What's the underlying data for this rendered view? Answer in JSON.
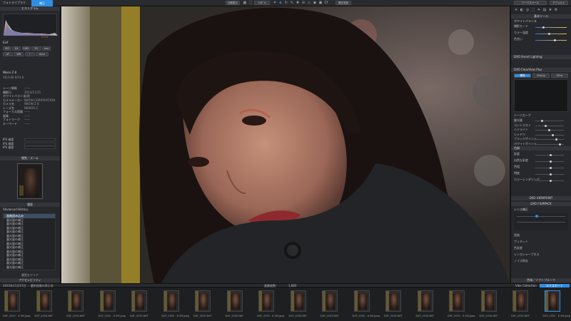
{
  "topbar": {
    "tab_label": "フォトライブラリ",
    "active_tab": "補正",
    "compare_label": "比較表示",
    "zoom_label": "100 %",
    "preview_label": "Cf",
    "export_label": "補正前後",
    "right_label": "ワークスペース",
    "right_btn": "デフォルト"
  },
  "left": {
    "histogram_title": "ヒストグラム",
    "hist_values": "0 0 0",
    "info_title": "Exif",
    "info_rows": [
      {
        "k": "シーン情報",
        "v": "——"
      },
      {
        "k": "撮影日",
        "v": "2023/11/15"
      },
      {
        "k": "ホワイトバランス",
        "v": "自動"
      },
      {
        "k": "カメラメーカー",
        "v": "NIKON CORPORATION"
      },
      {
        "k": "カメラ名",
        "v": "NIKON Z 8"
      },
      {
        "k": "レンズ名",
        "v": "NIKKOR Z"
      },
      {
        "k": "フォーカス距離",
        "v": "——"
      },
      {
        "k": "画質",
        "v": "——"
      },
      {
        "k": "フォトマーク",
        "v": "——"
      },
      {
        "k": "キーワード",
        "v": "——"
      }
    ],
    "camera_text": "Nikon Z 8",
    "camera_sub": "28.0-80.0/F4.0",
    "ips_rows": [
      "IPS 検索",
      "IPS 検索",
      "IPS 検索"
    ],
    "navigator_title": "閲覧／ズーム",
    "history_title": "履歴",
    "history_header": "Advanced History",
    "history_items": [
      "画像読み込み",
      "露光量の補正",
      "露光量の補正",
      "露光量の補正",
      "露光量の補正",
      "露光量の補正",
      "露光量の補正",
      "露光量の補正",
      "露光量の補正",
      "露光量の補正",
      "露光量の補正",
      "露光量の補正",
      "露光量の補正",
      "露光量の補正"
    ],
    "history_footer": "履歴をクリア",
    "bottom_tab": "アクセシビリティ"
  },
  "right": {
    "header": "基本ツール",
    "section1": "ホワイトバランス",
    "wb_rows": [
      "撮影モード",
      "カラー温度",
      "色合い"
    ],
    "section2": "DXO Smart Lighting",
    "section3": "DXO ClearView Plus",
    "preset_labels": [
      "標準",
      "Strong",
      "Ultra"
    ],
    "section4": "トーンカーブ",
    "slider_labels": [
      "露光量",
      "コントラスト",
      "ハイライト",
      "シャドウ",
      "ブラックポイント",
      "ホワイトポイント"
    ],
    "section5": "色調",
    "color_rows": [
      "彩度",
      "自然な彩度",
      "色相",
      "明度",
      "カラーレンダリング"
    ],
    "section6": "DXO VIEWPOINT",
    "section7": "DXO FILMPACK",
    "section8": "レンズ補正",
    "lens_rows": [
      "歪曲",
      "ヴィネット",
      "色収差",
      "レンズシャープネス",
      "ノイズ除去"
    ],
    "bottom_label": "色域／ソフトプルーフ"
  },
  "filmbar": {
    "left_text": "2023年11月15日 ... 選択画像の表示名",
    "center_text": "画像枚数：",
    "count": "1,883",
    "collection": "Vibe Collection",
    "export_btn": "エクスポート"
  },
  "film": {
    "labels": [
      "DXF_2030 - 8 0M.jpeg",
      "DXF_2030.NEF",
      "DXF_2030.NEF",
      "DXF_2030 - 8 0M.jpeg",
      "DXF_2030.NEF",
      "DXF_2030 - 8 0M.jpeg",
      "DXF_2030.NEF",
      "DXF_2030.NEF",
      "DXF_2030 - 8 0M.jpeg",
      "DXF_2030.NEF",
      "DXF_2030.NEF",
      "DXF_2030 - 8 0M.jpeg",
      "DXF_2030.NEF",
      "DXF_2030.NEF",
      "DXF_2030 - 8 0M.jpeg",
      "DXF_2030.NEF",
      "DXF_2030.NEF",
      "DXF_2030 - 8 0M.jpeg"
    ]
  },
  "colors": {
    "accent": "#2f8de4",
    "panel": "#27282b"
  }
}
